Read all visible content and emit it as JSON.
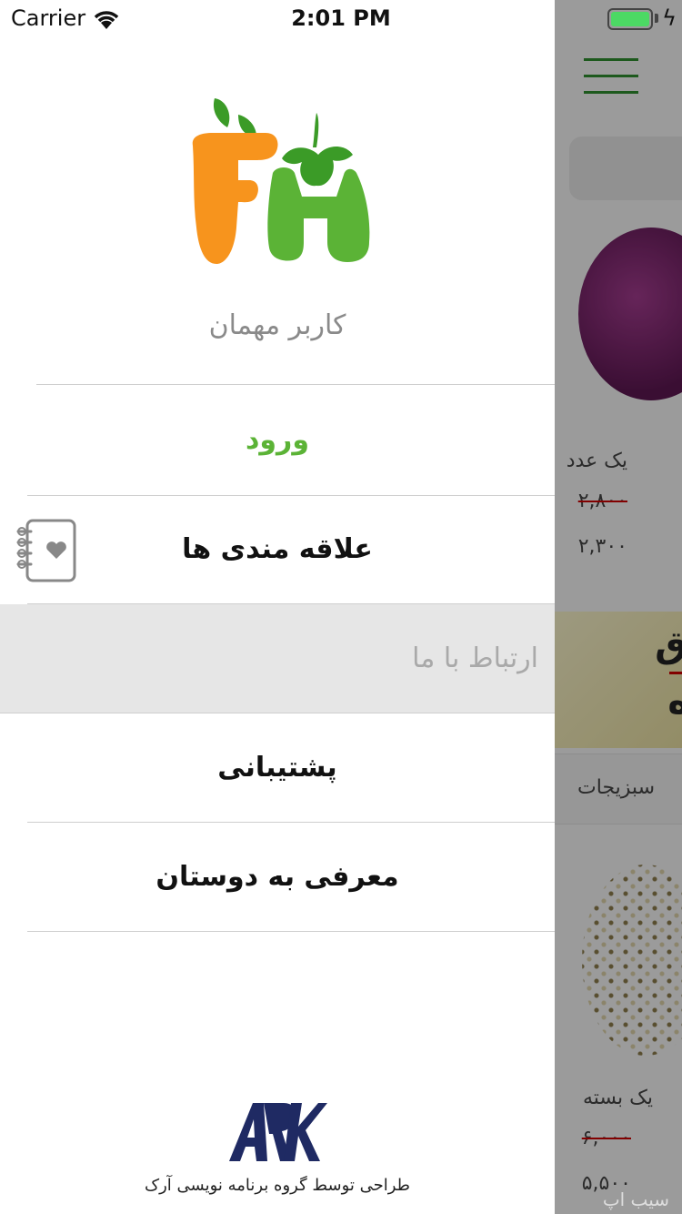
{
  "status_bar": {
    "carrier": "Carrier",
    "time": "2:01 PM"
  },
  "drawer": {
    "guest_label": "کاربر مهمان",
    "menu": {
      "login": "ورود",
      "favorites": "علاقه مندی ها",
      "contact": "ارتباط با ما",
      "support": "پشتیبانی",
      "invite": "معرفی به دوستان"
    },
    "footer_credit": "طراحی توسط گروه برنامه نویسی آرک"
  },
  "background": {
    "product1_unit": "یک عدد",
    "product1_old_price": "۲,۸۰۰",
    "product1_price": "۲,۳۰۰",
    "category": "سبزیجات",
    "product2_unit": "یک بسته",
    "product2_old_price": "۶,۰۰۰",
    "product2_price": "۵,۵۰۰",
    "watermark": "سیب اپ"
  },
  "colors": {
    "brand_green": "#5bb336",
    "brand_orange": "#f7941d",
    "ark_navy": "#1f2a63",
    "selected_row": "#e6e6e6"
  }
}
